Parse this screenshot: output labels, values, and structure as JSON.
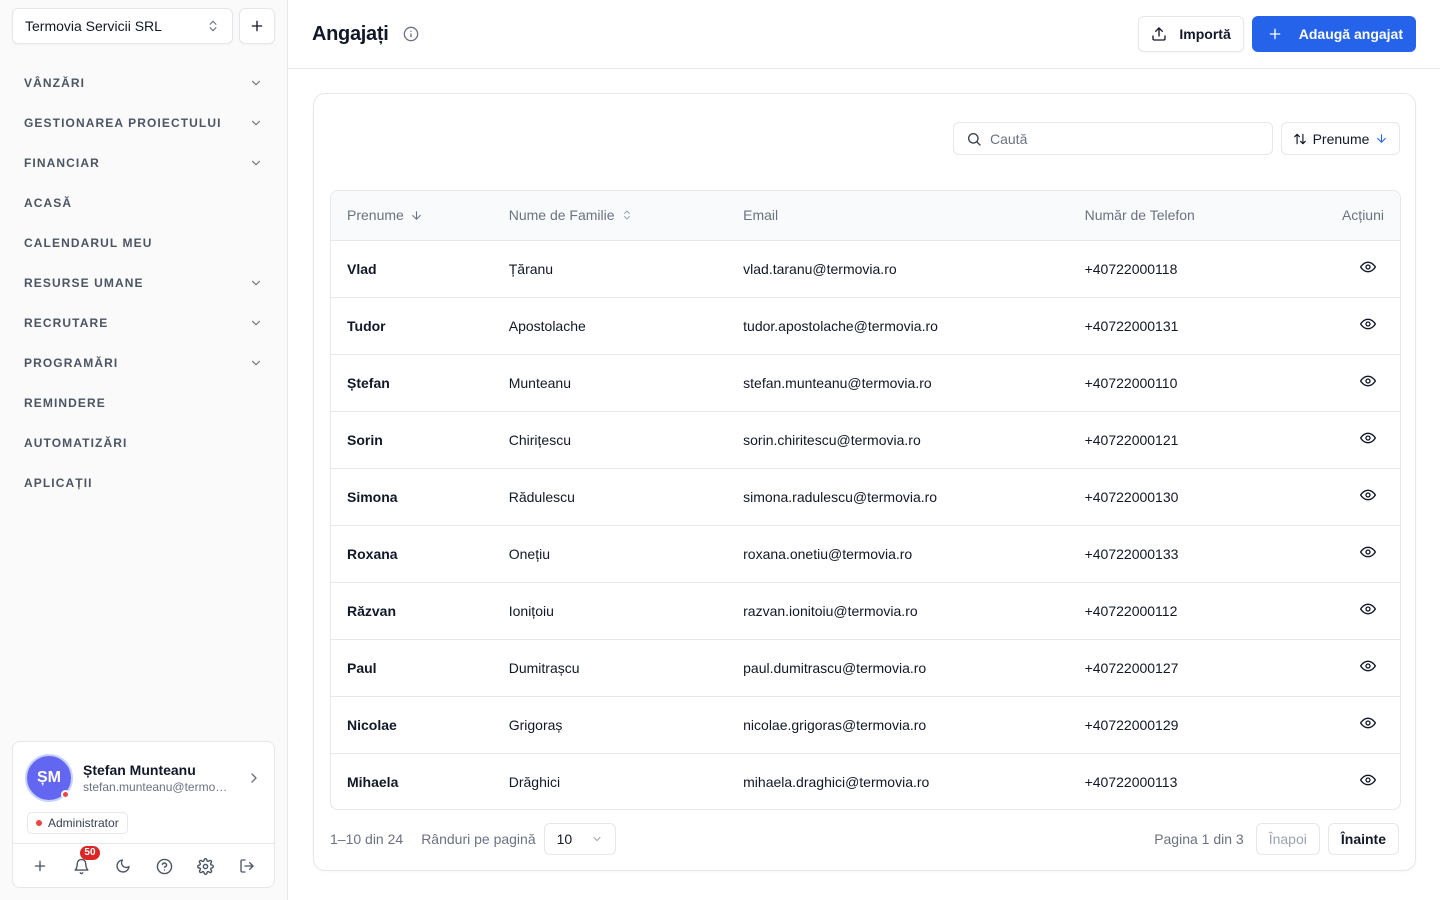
{
  "sidebar": {
    "org_name": "Termovia Servicii SRL",
    "nav": [
      {
        "label": "VÂNZĂRI",
        "expandable": true
      },
      {
        "label": "GESTIONAREA PROIECTULUI",
        "expandable": true
      },
      {
        "label": "FINANCIAR",
        "expandable": true
      },
      {
        "label": "ACASĂ",
        "expandable": false
      },
      {
        "label": "CALENDARUL MEU",
        "expandable": false
      },
      {
        "label": "RESURSE UMANE",
        "expandable": true
      },
      {
        "label": "RECRUTARE",
        "expandable": true
      },
      {
        "label": "PROGRAMĂRI",
        "expandable": true
      },
      {
        "label": "REMINDERE",
        "expandable": false
      },
      {
        "label": "AUTOMATIZĂRI",
        "expandable": false
      },
      {
        "label": "APLICAȚII",
        "expandable": false
      }
    ],
    "user": {
      "initials": "ȘM",
      "name": "Ștefan Munteanu",
      "email": "stefan.munteanu@termovia.ro",
      "role": "Administrator",
      "notifications": "50"
    }
  },
  "header": {
    "title": "Angajați",
    "import_label": "Importă",
    "add_label": "Adaugă angajat"
  },
  "toolbar": {
    "search_placeholder": "Caută",
    "search_value": "",
    "sort_label": "Prenume"
  },
  "table": {
    "columns": [
      "Prenume",
      "Nume de Familie",
      "Email",
      "Număr de Telefon",
      "Acțiuni"
    ],
    "rows": [
      {
        "first": "Vlad",
        "last": "Țăranu",
        "email": "vlad.taranu@termovia.ro",
        "phone": "+40722000118"
      },
      {
        "first": "Tudor",
        "last": "Apostolache",
        "email": "tudor.apostolache@termovia.ro",
        "phone": "+40722000131"
      },
      {
        "first": "Ștefan",
        "last": "Munteanu",
        "email": "stefan.munteanu@termovia.ro",
        "phone": "+40722000110"
      },
      {
        "first": "Sorin",
        "last": "Chirițescu",
        "email": "sorin.chiritescu@termovia.ro",
        "phone": "+40722000121"
      },
      {
        "first": "Simona",
        "last": "Rădulescu",
        "email": "simona.radulescu@termovia.ro",
        "phone": "+40722000130"
      },
      {
        "first": "Roxana",
        "last": "Onețiu",
        "email": "roxana.onetiu@termovia.ro",
        "phone": "+40722000133"
      },
      {
        "first": "Răzvan",
        "last": "Ionițoiu",
        "email": "razvan.ionitoiu@termovia.ro",
        "phone": "+40722000112"
      },
      {
        "first": "Paul",
        "last": "Dumitrașcu",
        "email": "paul.dumitrascu@termovia.ro",
        "phone": "+40722000127"
      },
      {
        "first": "Nicolae",
        "last": "Grigoraș",
        "email": "nicolae.grigoras@termovia.ro",
        "phone": "+40722000129"
      },
      {
        "first": "Mihaela",
        "last": "Drăghici",
        "email": "mihaela.draghici@termovia.ro",
        "phone": "+40722000113"
      }
    ]
  },
  "pagination": {
    "range": "1–10 din 24",
    "rows_per_page_label": "Rânduri pe pagină",
    "rows_per_page": "10",
    "page_info": "Pagina 1 din 3",
    "prev_label": "Înapoi",
    "next_label": "Înainte"
  },
  "colors": {
    "primary": "#2563eb",
    "avatar": "#6366f1",
    "danger": "#ef4444"
  }
}
